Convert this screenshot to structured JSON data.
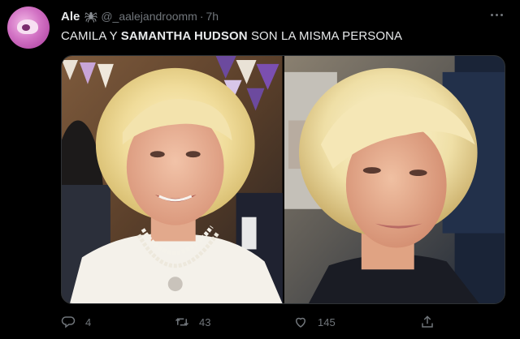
{
  "author": {
    "name": "Ale",
    "emoji_icon": "spider-icon",
    "handle": "@_aalejandroomm",
    "separator": "·",
    "time": "7h"
  },
  "tweet": {
    "text_parts": [
      {
        "text": "CAMILA Y ",
        "bold": false
      },
      {
        "text": "SAMANTHA HUDSON",
        "bold": true
      },
      {
        "text": " SON LA MISMA PERSONA",
        "bold": false
      }
    ]
  },
  "actions": {
    "reply_count": "4",
    "retweet_count": "43",
    "like_count": "145"
  },
  "colors": {
    "background": "#000000",
    "text_primary": "#e7e9ea",
    "text_secondary": "#71767b",
    "border": "#2f3336"
  }
}
